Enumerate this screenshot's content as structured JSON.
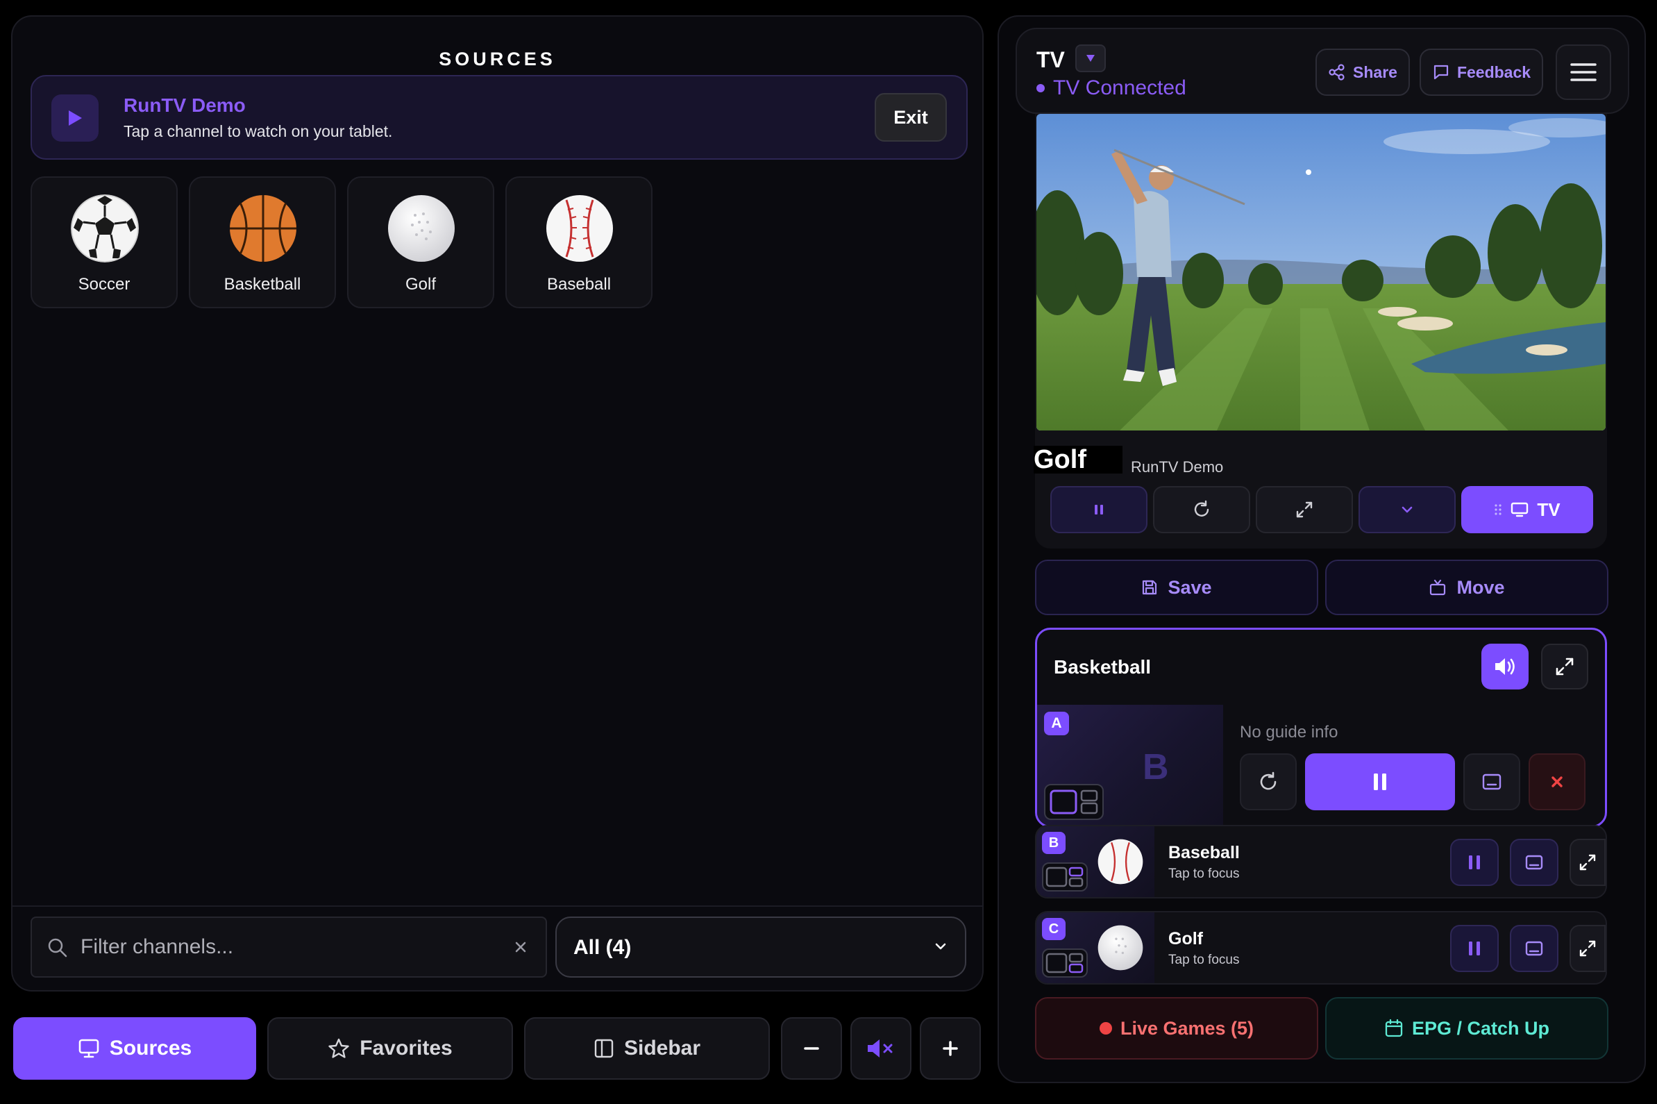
{
  "sources": {
    "title": "SOURCES",
    "demo": {
      "title": "RunTV Demo",
      "subtitle": "Tap a channel to watch on your tablet.",
      "exit_label": "Exit"
    },
    "channels": [
      {
        "name": "Soccer",
        "icon": "soccer-ball-icon"
      },
      {
        "name": "Basketball",
        "icon": "basketball-icon"
      },
      {
        "name": "Golf",
        "icon": "golf-ball-icon"
      },
      {
        "name": "Baseball",
        "icon": "baseball-icon"
      }
    ],
    "filter": {
      "placeholder": "Filter channels...",
      "value": ""
    },
    "category_select": {
      "value": "All (4)"
    }
  },
  "bottom_nav": {
    "sources_label": "Sources",
    "favorites_label": "Favorites",
    "sidebar_label": "Sidebar"
  },
  "tv": {
    "title": "TV",
    "status": "TV Connected",
    "share_label": "Share",
    "feedback_label": "Feedback",
    "now_playing": {
      "title": "Golf",
      "source": "RunTV Demo"
    },
    "cast_label": "TV",
    "save_label": "Save",
    "move_label": "Move",
    "focus_slot": {
      "title": "Basketball",
      "slot": "A",
      "thumb_letter": "B",
      "guide": "No guide info"
    },
    "slots": [
      {
        "slot": "B",
        "title": "Baseball",
        "subtitle": "Tap to focus"
      },
      {
        "slot": "C",
        "title": "Golf",
        "subtitle": "Tap to focus"
      }
    ],
    "live_games_label": "Live Games (5)",
    "epg_label": "EPG / Catch Up"
  },
  "colors": {
    "accent": "#7c4dff",
    "accent_text": "#8b5cf6",
    "live": "#ef4444",
    "epg": "#5eead4"
  }
}
